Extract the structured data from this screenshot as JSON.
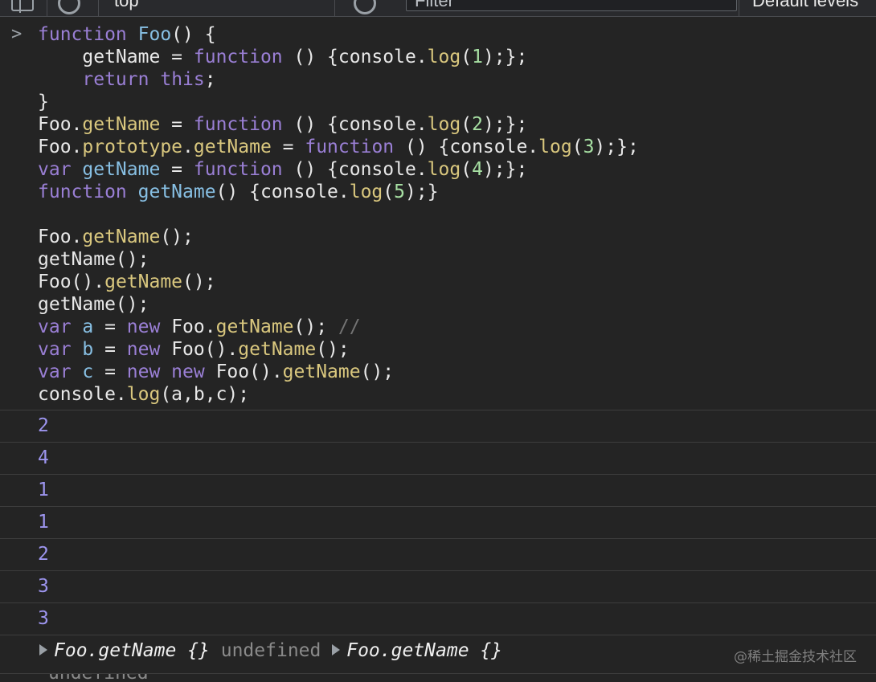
{
  "toolbar": {
    "context": "top",
    "filter_placeholder": "Filter",
    "levels": "Default levels"
  },
  "input_code": [
    [
      [
        "kw",
        "function "
      ],
      [
        "fn",
        "Foo"
      ],
      [
        "pl",
        "() {"
      ]
    ],
    [
      [
        "pl",
        "    getName = "
      ],
      [
        "kw",
        "function"
      ],
      [
        "pl",
        " () {console."
      ],
      [
        "me",
        "log"
      ],
      [
        "pl",
        "("
      ],
      [
        "nu",
        "1"
      ],
      [
        "pl",
        ");};"
      ]
    ],
    [
      [
        "pl",
        "    "
      ],
      [
        "kw",
        "return"
      ],
      [
        "pl",
        " "
      ],
      [
        "kw",
        "this"
      ],
      [
        "pl",
        ";"
      ]
    ],
    [
      [
        "pl",
        "}"
      ]
    ],
    [
      [
        "pl",
        "Foo."
      ],
      [
        "me",
        "getName"
      ],
      [
        "pl",
        " = "
      ],
      [
        "kw",
        "function"
      ],
      [
        "pl",
        " () {console."
      ],
      [
        "me",
        "log"
      ],
      [
        "pl",
        "("
      ],
      [
        "nu",
        "2"
      ],
      [
        "pl",
        ");};"
      ]
    ],
    [
      [
        "pl",
        "Foo."
      ],
      [
        "me",
        "prototype"
      ],
      [
        "pl",
        "."
      ],
      [
        "me",
        "getName"
      ],
      [
        "pl",
        " = "
      ],
      [
        "kw",
        "function"
      ],
      [
        "pl",
        " () {console."
      ],
      [
        "me",
        "log"
      ],
      [
        "pl",
        "("
      ],
      [
        "nu",
        "3"
      ],
      [
        "pl",
        ");};"
      ]
    ],
    [
      [
        "kw",
        "var "
      ],
      [
        "fn",
        "getName"
      ],
      [
        "pl",
        " = "
      ],
      [
        "kw",
        "function"
      ],
      [
        "pl",
        " () {console."
      ],
      [
        "me",
        "log"
      ],
      [
        "pl",
        "("
      ],
      [
        "nu",
        "4"
      ],
      [
        "pl",
        ");};"
      ]
    ],
    [
      [
        "kw",
        "function "
      ],
      [
        "fn",
        "getName"
      ],
      [
        "pl",
        "() {console."
      ],
      [
        "me",
        "log"
      ],
      [
        "pl",
        "("
      ],
      [
        "nu",
        "5"
      ],
      [
        "pl",
        ");}"
      ]
    ],
    [
      [
        "pl",
        ""
      ]
    ],
    [
      [
        "pl",
        "Foo."
      ],
      [
        "me",
        "getName"
      ],
      [
        "pl",
        "();"
      ]
    ],
    [
      [
        "pl",
        "getName();"
      ]
    ],
    [
      [
        "pl",
        "Foo()."
      ],
      [
        "me",
        "getName"
      ],
      [
        "pl",
        "();"
      ]
    ],
    [
      [
        "pl",
        "getName();"
      ]
    ],
    [
      [
        "kw",
        "var "
      ],
      [
        "fn",
        "a"
      ],
      [
        "pl",
        " = "
      ],
      [
        "kw",
        "new"
      ],
      [
        "pl",
        " Foo."
      ],
      [
        "me",
        "getName"
      ],
      [
        "pl",
        "(); "
      ],
      [
        "cm",
        "//"
      ]
    ],
    [
      [
        "kw",
        "var "
      ],
      [
        "fn",
        "b"
      ],
      [
        "pl",
        " = "
      ],
      [
        "kw",
        "new"
      ],
      [
        "pl",
        " Foo()."
      ],
      [
        "me",
        "getName"
      ],
      [
        "pl",
        "();"
      ]
    ],
    [
      [
        "kw",
        "var "
      ],
      [
        "fn",
        "c"
      ],
      [
        "pl",
        " = "
      ],
      [
        "kw",
        "new new"
      ],
      [
        "pl",
        " Foo()."
      ],
      [
        "me",
        "getName"
      ],
      [
        "pl",
        "();"
      ]
    ],
    [
      [
        "pl",
        "console."
      ],
      [
        "me",
        "log"
      ],
      [
        "pl",
        "(a,b,c);"
      ]
    ]
  ],
  "outputs": [
    "2",
    "4",
    "1",
    "1",
    "2",
    "3",
    "3"
  ],
  "final_log": {
    "obj_a": "Foo.getName {}",
    "middle": "undefined",
    "obj_c": "Foo.getName {}"
  },
  "return_value": "undefined",
  "watermark": "@稀土掘金技术社区",
  "colors": {
    "background": "#242424",
    "keyword": "#9a7fd5",
    "identifier": "#87bfe3",
    "method": "#d9c77e",
    "number": "#a7e0a3",
    "output_number": "#9d95ef"
  }
}
